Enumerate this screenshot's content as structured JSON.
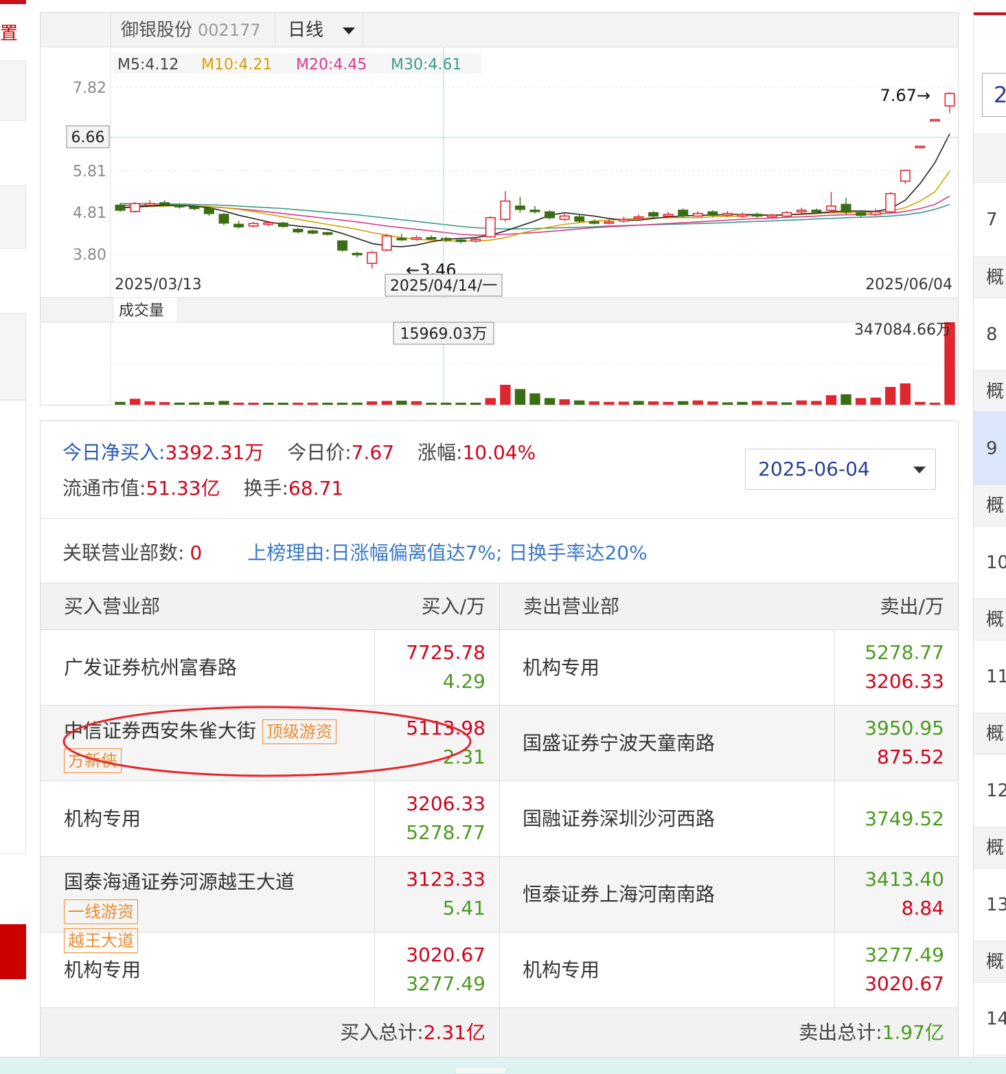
{
  "left_nav": {
    "label": "置"
  },
  "chart": {
    "stock_name": "御银股份",
    "stock_code": "002177",
    "period": "日线",
    "ma_labels": [
      {
        "text": "M5:4.12",
        "color": "#444444"
      },
      {
        "text": "M10:4.21",
        "color": "#d4a000"
      },
      {
        "text": "M20:4.45",
        "color": "#d63a8c"
      },
      {
        "text": "M30:4.61",
        "color": "#3a9a86"
      }
    ],
    "y_ticks": [
      "7.82",
      "5.81",
      "4.81",
      "3.80"
    ],
    "crosshair_price": "6.66",
    "crosshair_date": "2025/04/14/一",
    "max_label": "7.67→",
    "min_label": "←3.46",
    "date_start": "2025/03/13",
    "date_end": "2025/06/04",
    "volume_title": "成交量",
    "volume_crosshair": "15969.03万",
    "volume_max": "347084.66万",
    "colors": {
      "up": "#e0262f",
      "down": "#3a6e14"
    }
  },
  "chart_data": {
    "type": "candlestick",
    "y_ticks": [
      7.82,
      5.81,
      4.81,
      3.8
    ],
    "up_color": "#e0262f",
    "down_color": "#3a6e14",
    "candles": [
      {
        "o": 4.98,
        "c": 4.86,
        "h": 5.02,
        "l": 4.82
      },
      {
        "o": 4.83,
        "c": 5.02,
        "h": 5.06,
        "l": 4.8
      },
      {
        "o": 4.98,
        "c": 5.02,
        "h": 5.1,
        "l": 4.95
      },
      {
        "o": 5.04,
        "c": 5.0,
        "h": 5.1,
        "l": 4.96
      },
      {
        "o": 4.98,
        "c": 4.94,
        "h": 5.02,
        "l": 4.9
      },
      {
        "o": 4.94,
        "c": 4.9,
        "h": 4.98,
        "l": 4.86
      },
      {
        "o": 4.9,
        "c": 4.78,
        "h": 4.93,
        "l": 4.72
      },
      {
        "o": 4.76,
        "c": 4.55,
        "h": 4.79,
        "l": 4.5
      },
      {
        "o": 4.52,
        "c": 4.46,
        "h": 4.6,
        "l": 4.42
      },
      {
        "o": 4.48,
        "c": 4.54,
        "h": 4.58,
        "l": 4.44
      },
      {
        "o": 4.52,
        "c": 4.56,
        "h": 4.6,
        "l": 4.48
      },
      {
        "o": 4.55,
        "c": 4.47,
        "h": 4.58,
        "l": 4.44
      },
      {
        "o": 4.4,
        "c": 4.34,
        "h": 4.44,
        "l": 4.3
      },
      {
        "o": 4.36,
        "c": 4.31,
        "h": 4.39,
        "l": 4.28
      },
      {
        "o": 4.32,
        "c": 4.28,
        "h": 4.34,
        "l": 4.25
      },
      {
        "o": 4.12,
        "c": 3.9,
        "h": 4.14,
        "l": 3.86
      },
      {
        "o": 3.82,
        "c": 3.8,
        "h": 3.86,
        "l": 3.72
      },
      {
        "o": 3.58,
        "c": 3.84,
        "h": 3.88,
        "l": 3.46
      },
      {
        "o": 3.9,
        "c": 4.24,
        "h": 4.28,
        "l": 3.88
      },
      {
        "o": 4.18,
        "c": 4.16,
        "h": 4.3,
        "l": 4.12
      },
      {
        "o": 4.16,
        "c": 4.2,
        "h": 4.26,
        "l": 4.12
      },
      {
        "o": 4.2,
        "c": 4.18,
        "h": 4.26,
        "l": 4.14
      },
      {
        "o": 4.18,
        "c": 4.14,
        "h": 4.22,
        "l": 4.1
      },
      {
        "o": 4.14,
        "c": 4.12,
        "h": 4.2,
        "l": 4.06
      },
      {
        "o": 4.12,
        "c": 4.16,
        "h": 4.22,
        "l": 4.08
      },
      {
        "o": 4.22,
        "c": 4.68,
        "h": 4.72,
        "l": 4.2
      },
      {
        "o": 4.64,
        "c": 5.08,
        "h": 5.32,
        "l": 4.58
      },
      {
        "o": 4.96,
        "c": 4.88,
        "h": 5.18,
        "l": 4.8
      },
      {
        "o": 4.86,
        "c": 4.84,
        "h": 4.96,
        "l": 4.78
      },
      {
        "o": 4.82,
        "c": 4.68,
        "h": 4.86,
        "l": 4.64
      },
      {
        "o": 4.64,
        "c": 4.72,
        "h": 4.8,
        "l": 4.6
      },
      {
        "o": 4.7,
        "c": 4.6,
        "h": 4.76,
        "l": 4.56
      },
      {
        "o": 4.58,
        "c": 4.56,
        "h": 4.64,
        "l": 4.52
      },
      {
        "o": 4.56,
        "c": 4.58,
        "h": 4.64,
        "l": 4.52
      },
      {
        "o": 4.6,
        "c": 4.64,
        "h": 4.7,
        "l": 4.56
      },
      {
        "o": 4.68,
        "c": 4.7,
        "h": 4.76,
        "l": 4.64
      },
      {
        "o": 4.8,
        "c": 4.72,
        "h": 4.84,
        "l": 4.68
      },
      {
        "o": 4.72,
        "c": 4.76,
        "h": 4.82,
        "l": 4.68
      },
      {
        "o": 4.86,
        "c": 4.72,
        "h": 4.9,
        "l": 4.68
      },
      {
        "o": 4.72,
        "c": 4.78,
        "h": 4.84,
        "l": 4.7
      },
      {
        "o": 4.82,
        "c": 4.74,
        "h": 4.86,
        "l": 4.7
      },
      {
        "o": 4.74,
        "c": 4.78,
        "h": 4.84,
        "l": 4.7
      },
      {
        "o": 4.72,
        "c": 4.76,
        "h": 4.8,
        "l": 4.68
      },
      {
        "o": 4.76,
        "c": 4.72,
        "h": 4.8,
        "l": 4.68
      },
      {
        "o": 4.7,
        "c": 4.74,
        "h": 4.78,
        "l": 4.66
      },
      {
        "o": 4.72,
        "c": 4.8,
        "h": 4.84,
        "l": 4.7
      },
      {
        "o": 4.82,
        "c": 4.86,
        "h": 4.92,
        "l": 4.78
      },
      {
        "o": 4.86,
        "c": 4.82,
        "h": 4.9,
        "l": 4.78
      },
      {
        "o": 4.86,
        "c": 4.96,
        "h": 5.3,
        "l": 4.8
      },
      {
        "o": 5.0,
        "c": 4.82,
        "h": 5.16,
        "l": 4.76
      },
      {
        "o": 4.8,
        "c": 4.74,
        "h": 4.86,
        "l": 4.7
      },
      {
        "o": 4.76,
        "c": 4.82,
        "h": 4.9,
        "l": 4.72
      },
      {
        "o": 4.82,
        "c": 5.26,
        "h": 5.3,
        "l": 4.8
      },
      {
        "o": 5.56,
        "c": 5.82,
        "h": 5.84,
        "l": 5.5
      },
      {
        "o": 6.4,
        "c": 6.4,
        "h": 6.4,
        "l": 6.4
      },
      {
        "o": 7.04,
        "c": 7.04,
        "h": 7.04,
        "l": 7.04
      },
      {
        "o": 7.37,
        "c": 7.67,
        "h": 7.7,
        "l": 7.2
      }
    ],
    "ma5": [
      4.92,
      4.94,
      4.96,
      4.98,
      4.98,
      4.96,
      4.92,
      4.84,
      4.74,
      4.66,
      4.58,
      4.52,
      4.48,
      4.44,
      4.4,
      4.3,
      4.18,
      4.06,
      4.0,
      3.98,
      4.02,
      4.1,
      4.16,
      4.18,
      4.2,
      4.26,
      4.36,
      4.48,
      4.6,
      4.74,
      4.8,
      4.76,
      4.72,
      4.66,
      4.62,
      4.62,
      4.66,
      4.7,
      4.72,
      4.74,
      4.74,
      4.76,
      4.76,
      4.75,
      4.74,
      4.75,
      4.77,
      4.79,
      4.82,
      4.84,
      4.84,
      4.83,
      4.9,
      5.1,
      5.5,
      6.0,
      6.7
    ],
    "ma10": [
      4.92,
      4.93,
      4.95,
      4.96,
      4.97,
      4.97,
      4.95,
      4.92,
      4.88,
      4.83,
      4.76,
      4.7,
      4.64,
      4.58,
      4.52,
      4.46,
      4.4,
      4.32,
      4.26,
      4.2,
      4.16,
      4.14,
      4.12,
      4.12,
      4.12,
      4.14,
      4.2,
      4.3,
      4.38,
      4.46,
      4.52,
      4.56,
      4.6,
      4.62,
      4.64,
      4.66,
      4.68,
      4.68,
      4.68,
      4.68,
      4.7,
      4.71,
      4.72,
      4.73,
      4.74,
      4.75,
      4.76,
      4.78,
      4.8,
      4.8,
      4.81,
      4.81,
      4.84,
      4.92,
      5.08,
      5.3,
      5.8
    ],
    "ma20": [
      4.98,
      4.98,
      4.98,
      4.98,
      4.97,
      4.96,
      4.94,
      4.92,
      4.89,
      4.86,
      4.82,
      4.78,
      4.74,
      4.7,
      4.66,
      4.62,
      4.58,
      4.53,
      4.48,
      4.44,
      4.4,
      4.36,
      4.32,
      4.28,
      4.26,
      4.26,
      4.28,
      4.3,
      4.32,
      4.35,
      4.38,
      4.41,
      4.44,
      4.46,
      4.48,
      4.5,
      4.52,
      4.54,
      4.56,
      4.58,
      4.6,
      4.62,
      4.64,
      4.66,
      4.67,
      4.69,
      4.7,
      4.72,
      4.74,
      4.75,
      4.76,
      4.77,
      4.79,
      4.83,
      4.9,
      5.0,
      5.2
    ],
    "ma30": [
      5.02,
      5.02,
      5.02,
      5.01,
      5.01,
      5.0,
      4.99,
      4.98,
      4.96,
      4.94,
      4.92,
      4.9,
      4.87,
      4.84,
      4.81,
      4.78,
      4.75,
      4.71,
      4.67,
      4.63,
      4.59,
      4.55,
      4.51,
      4.47,
      4.44,
      4.42,
      4.41,
      4.41,
      4.42,
      4.43,
      4.44,
      4.45,
      4.46,
      4.48,
      4.49,
      4.5,
      4.51,
      4.52,
      4.53,
      4.54,
      4.55,
      4.56,
      4.58,
      4.59,
      4.6,
      4.62,
      4.63,
      4.65,
      4.66,
      4.68,
      4.69,
      4.7,
      4.72,
      4.75,
      4.8,
      4.88,
      5.0
    ],
    "volume_unit": "万",
    "volumes": [
      [
        12000,
        0
      ],
      [
        25000,
        1
      ],
      [
        14000,
        1
      ],
      [
        11000,
        1
      ],
      [
        9000,
        0
      ],
      [
        9500,
        0
      ],
      [
        11000,
        0
      ],
      [
        16000,
        0
      ],
      [
        7000,
        1
      ],
      [
        6500,
        1
      ],
      [
        6000,
        0
      ],
      [
        7000,
        0
      ],
      [
        5500,
        1
      ],
      [
        5000,
        1
      ],
      [
        4800,
        0
      ],
      [
        8000,
        0
      ],
      [
        9000,
        0
      ],
      [
        14000,
        1
      ],
      [
        15969.03,
        1
      ],
      [
        17000,
        0
      ],
      [
        15000,
        1
      ],
      [
        8000,
        0
      ],
      [
        7000,
        0
      ],
      [
        7500,
        0
      ],
      [
        7000,
        0
      ],
      [
        28000,
        1
      ],
      [
        84000,
        1
      ],
      [
        66000,
        0
      ],
      [
        48000,
        0
      ],
      [
        28000,
        0
      ],
      [
        23000,
        1
      ],
      [
        18000,
        0
      ],
      [
        14000,
        1
      ],
      [
        12000,
        1
      ],
      [
        13000,
        1
      ],
      [
        16000,
        0
      ],
      [
        14000,
        1
      ],
      [
        12000,
        1
      ],
      [
        15000,
        0
      ],
      [
        18000,
        1
      ],
      [
        14000,
        1
      ],
      [
        10000,
        0
      ],
      [
        12000,
        0
      ],
      [
        16000,
        1
      ],
      [
        14000,
        1
      ],
      [
        10000,
        0
      ],
      [
        18000,
        1
      ],
      [
        16000,
        1
      ],
      [
        40000,
        1
      ],
      [
        44000,
        0
      ],
      [
        28000,
        1
      ],
      [
        30000,
        1
      ],
      [
        75000,
        1
      ],
      [
        90000,
        1
      ],
      [
        12000,
        1
      ],
      [
        7000,
        1
      ],
      [
        347084.66,
        1
      ]
    ],
    "date_range": [
      "2025/03/13",
      "2025/06/04"
    ]
  },
  "summary": {
    "net_buy_label": "今日净买入:",
    "net_buy_value": "3392.31万",
    "price_label": "今日价:",
    "price_value": "7.67",
    "change_label": "涨幅:",
    "change_value": "10.04%",
    "float_cap_label": "流通市值:",
    "float_cap_value": "51.33亿",
    "turnover_label": "换手:",
    "turnover_value": "68.71",
    "date_select": "2025-06-04"
  },
  "reason": {
    "branches_label": "关联营业部数:",
    "branches_value": "0",
    "reason_label": "上榜理由:",
    "reason_text": "日涨幅偏离值达7%; 日换手率达20%"
  },
  "table": {
    "buy_header": "买入营业部",
    "buy_amount_header": "买入/万",
    "sell_header": "卖出营业部",
    "sell_amount_header": "卖出/万",
    "rows": [
      {
        "buy_name": "广发证券杭州富春路",
        "buy_tags": [],
        "buy_top": "7725.78",
        "buy_bottom": "4.29",
        "sell_name": "机构专用",
        "sell_top": "5278.77",
        "sell_bottom": "3206.33"
      },
      {
        "buy_name": "中信证券西安朱雀大街",
        "buy_tags": [
          "顶级游资",
          "方新侠"
        ],
        "buy_top": "5113.98",
        "buy_bottom": "2.31",
        "sell_name": "国盛证券宁波天童南路",
        "sell_top": "3950.95",
        "sell_bottom": "875.52"
      },
      {
        "buy_name": "机构专用",
        "buy_tags": [],
        "buy_top": "3206.33",
        "buy_bottom": "5278.77",
        "sell_name": "国融证券深圳沙河西路",
        "sell_top": "3749.52",
        "sell_bottom": ""
      },
      {
        "buy_name": "国泰海通证券河源越王大道",
        "buy_tags": [
          "一线游资",
          "越王大道"
        ],
        "buy_top": "3123.33",
        "buy_bottom": "5.41",
        "sell_name": "恒泰证券上海河南南路",
        "sell_top": "3413.40",
        "sell_bottom": "8.84"
      },
      {
        "buy_name": "机构专用",
        "buy_tags": [],
        "buy_top": "3020.67",
        "buy_bottom": "3277.49",
        "sell_name": "机构专用",
        "sell_top": "3277.49",
        "sell_bottom": "3020.67"
      }
    ],
    "buy_total_label": "买入总计:",
    "buy_total_value": "2.31亿",
    "sell_total_label": "卖出总计:",
    "sell_total_value": "1.97亿"
  },
  "right_nav": {
    "input_value": "2",
    "items": [
      {
        "label": "",
        "style": "gray"
      },
      {
        "label": "7",
        "style": "white"
      },
      {
        "label": "概",
        "style": "gray"
      },
      {
        "label": "8",
        "style": "white"
      },
      {
        "label": "概",
        "style": "gray"
      },
      {
        "label": "9",
        "style": "sel"
      },
      {
        "label": "概",
        "style": "gray"
      },
      {
        "label": "10",
        "style": "white"
      },
      {
        "label": "概",
        "style": "gray"
      },
      {
        "label": "11",
        "style": "white"
      },
      {
        "label": "概",
        "style": "gray"
      },
      {
        "label": "12",
        "style": "white"
      },
      {
        "label": "概",
        "style": "gray"
      },
      {
        "label": "13",
        "style": "white"
      },
      {
        "label": "概",
        "style": "gray"
      },
      {
        "label": "14",
        "style": "white"
      }
    ]
  }
}
